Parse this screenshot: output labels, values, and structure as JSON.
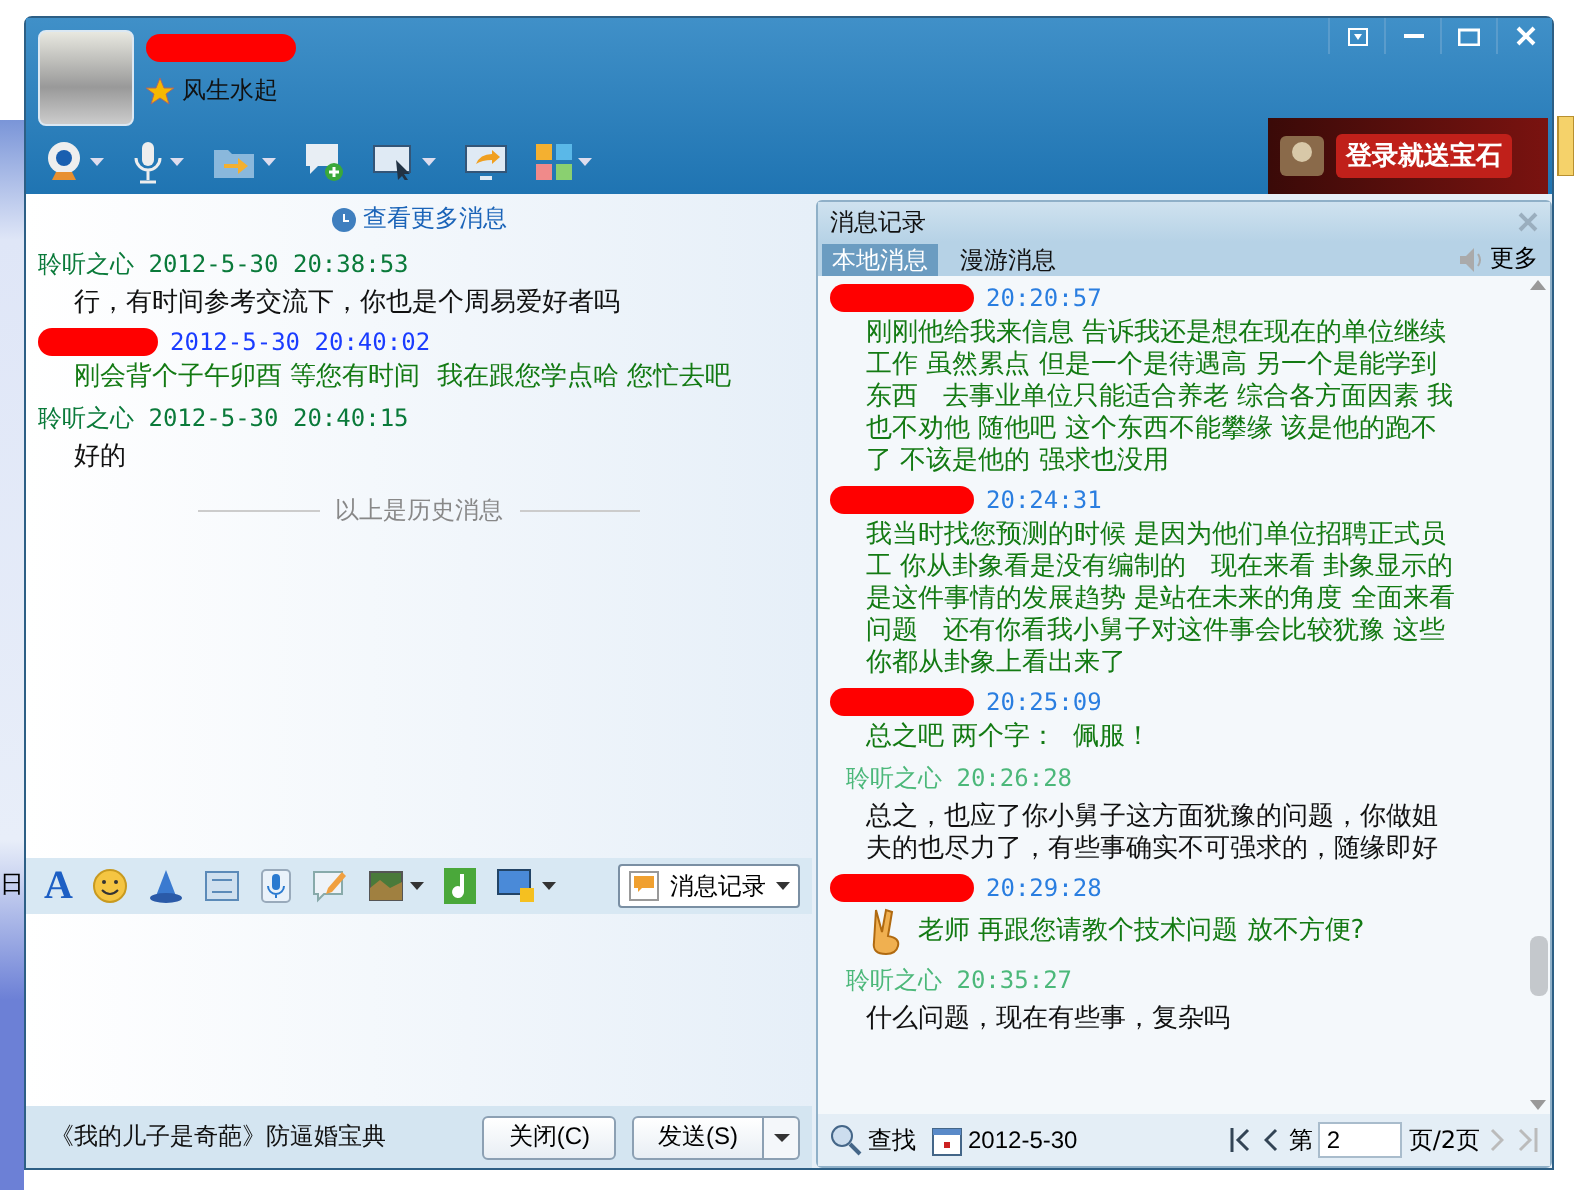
{
  "desktop": {
    "edge_text": "日"
  },
  "window": {
    "contact": {
      "name_redacted": true,
      "signature": "风生水起"
    },
    "ad_banner": {
      "text": "登录就送宝石"
    }
  },
  "chat": {
    "more_link": "查看更多消息",
    "messages": [
      {
        "kind": "self",
        "sender": "聆听之心",
        "time": "2012-5-30 20:38:53",
        "text": "行，有时间参考交流下，你也是个周易爱好者吗"
      },
      {
        "kind": "other",
        "time": "2012-5-30 20:40:02",
        "text": "刚会背个子午卯酉 等您有时间  我在跟您学点哈 您忙去吧"
      },
      {
        "kind": "self",
        "sender": "聆听之心",
        "time": "2012-5-30 20:40:15",
        "text": "好的"
      }
    ],
    "history_divider": "以上是历史消息",
    "format_toolbar": {
      "font_button": "A"
    },
    "history_button": "消息记录",
    "footer_link": "《我的儿子是奇葩》防逼婚宝典",
    "close_button": "关闭(C)",
    "send_button": "发送(S)"
  },
  "history": {
    "title": "消息记录",
    "tabs": [
      {
        "label": "本地消息",
        "selected": true
      },
      {
        "label": "漫游消息",
        "selected": false
      }
    ],
    "more": "更多",
    "messages": [
      {
        "kind": "other",
        "time": "20:20:57",
        "sticker": false,
        "text": "刚刚他给我来信息 告诉我还是想在现在的单位继续工作 虽然累点 但是一个是待遇高 另一个是能学到东西   去事业单位只能适合养老 综合各方面因素 我也不劝他 随他吧 这个东西不能攀缘 该是他的跑不了 不该是他的 强求也没用"
      },
      {
        "kind": "other",
        "time": "20:24:31",
        "sticker": false,
        "text": "我当时找您预测的时候 是因为他们单位招聘正式员工 你从卦象看是没有编制的   现在来看 卦象显示的是这件事情的发展趋势 是站在未来的角度 全面来看问题   还有你看我小舅子对这件事会比较犹豫 这些你都从卦象上看出来了"
      },
      {
        "kind": "other",
        "time": "20:25:09",
        "sticker": false,
        "text": "总之吧 两个字：  佩服！"
      },
      {
        "kind": "self",
        "sender": "聆听之心",
        "time": "20:26:28",
        "sticker": false,
        "text": "总之，也应了你小舅子这方面犹豫的问题，你做姐夫的也尽力了，有些事确实不可强求的，随缘即好"
      },
      {
        "kind": "other",
        "time": "20:29:28",
        "sticker": true,
        "text": "老师 再跟您请教个技术问题 放不方便?"
      },
      {
        "kind": "self",
        "sender": "聆听之心",
        "time": "20:35:27",
        "sticker": false,
        "text": "什么问题，现在有些事，复杂吗"
      }
    ],
    "search": "查找",
    "date": "2012-5-30",
    "pager": {
      "prefix": "第",
      "page": "2",
      "suffix": "页/2页"
    }
  }
}
